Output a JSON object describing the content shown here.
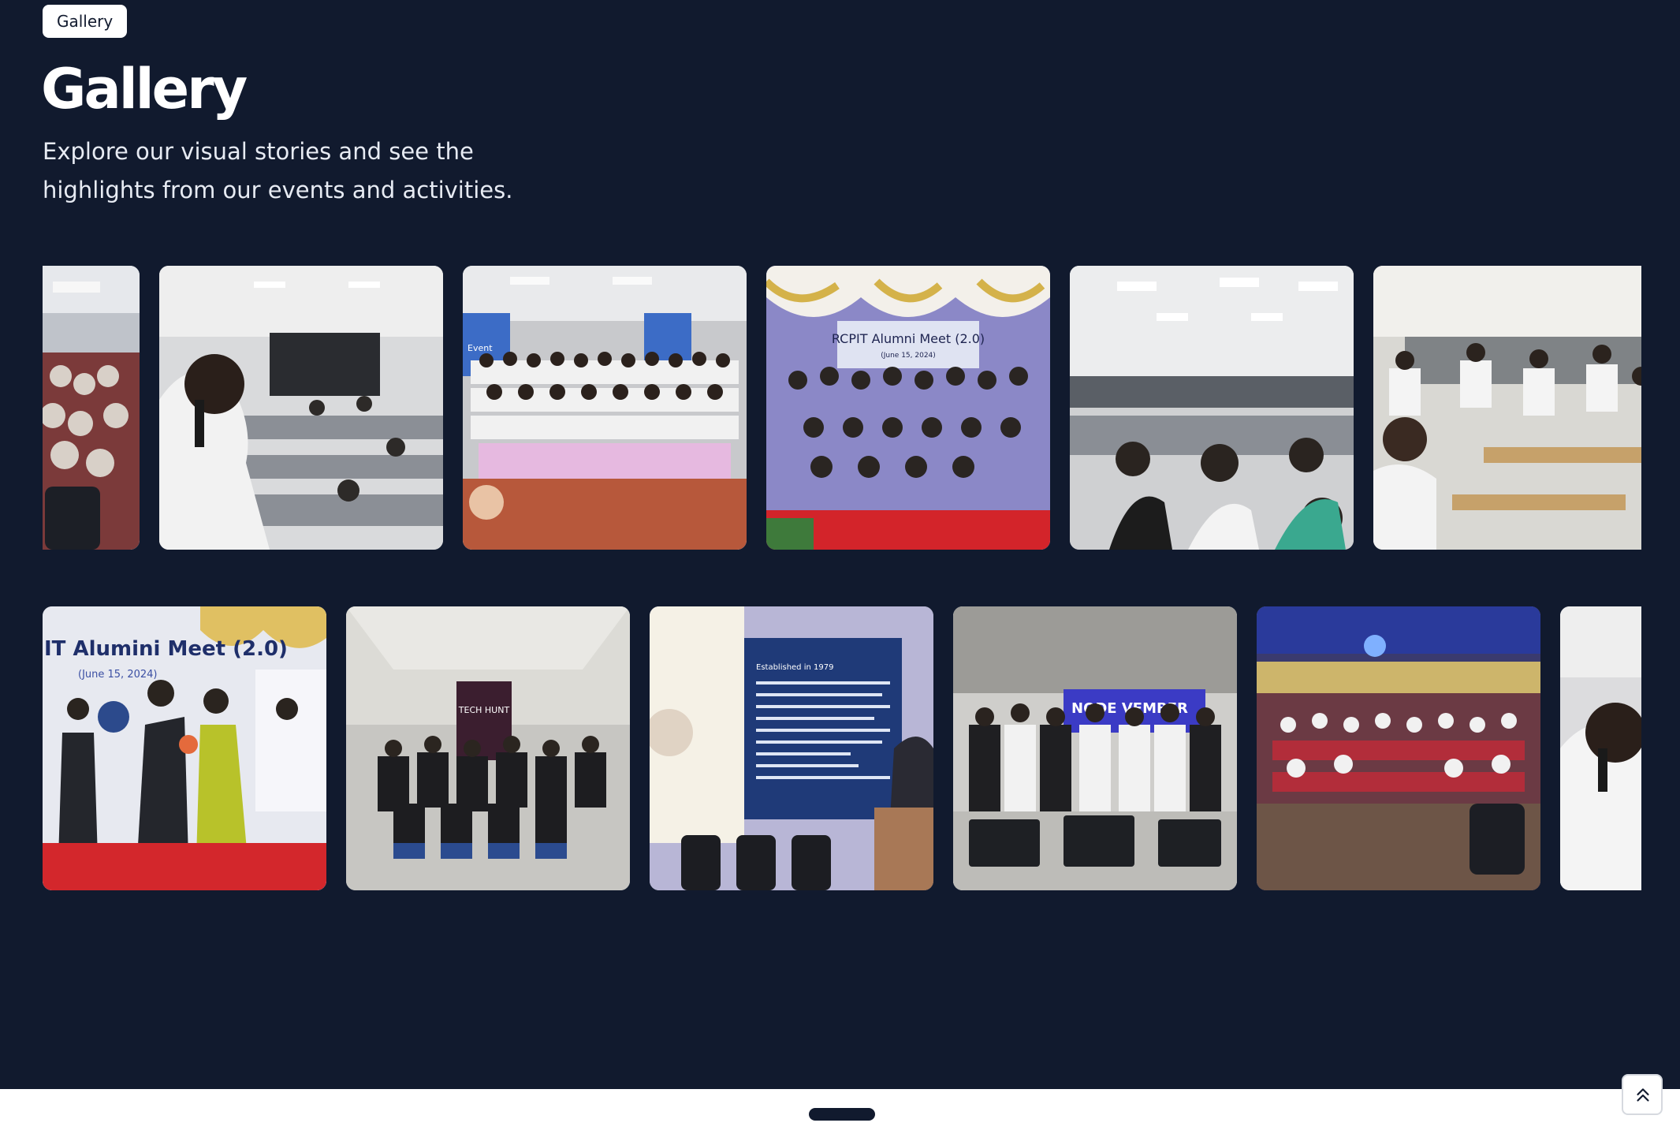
{
  "header": {
    "badge": "Gallery",
    "title": "Gallery",
    "subtitle": "Explore our visual stories and see the highlights from our events and activities."
  },
  "gallery": {
    "row1": [
      {
        "name": "auditorium-students-photo"
      },
      {
        "name": "computer-lab-speaker-photo"
      },
      {
        "name": "hackathon-group-photo",
        "sign": "Event"
      },
      {
        "name": "alumni-meet-group-photo",
        "sign": "RCPIT Alumni Meet (2.0)",
        "sign2": "(June 15, 2024)"
      },
      {
        "name": "computer-lab-students-photo"
      },
      {
        "name": "classroom-students-photo"
      }
    ],
    "row2": [
      {
        "name": "alumni-meet-felicitation-photo",
        "sign": "IT Alumini Meet (2.0)",
        "sign2": "(June 15, 2024)"
      },
      {
        "name": "tech-hunt-team-photo",
        "sign": "TECH HUNT"
      },
      {
        "name": "education-society-presentation-photo",
        "sign": "Established in 1979"
      },
      {
        "name": "nodevember-team-photo",
        "sign": "NODE VEMBER"
      },
      {
        "name": "auditorium-audience-photo"
      },
      {
        "name": "speaker-microphone-photo"
      }
    ]
  },
  "controls": {
    "scroll_top_icon": "chevrons-up-icon"
  },
  "colors": {
    "background": "#111a2e",
    "badge_background": "#ffffff",
    "title": "#ffffff"
  }
}
